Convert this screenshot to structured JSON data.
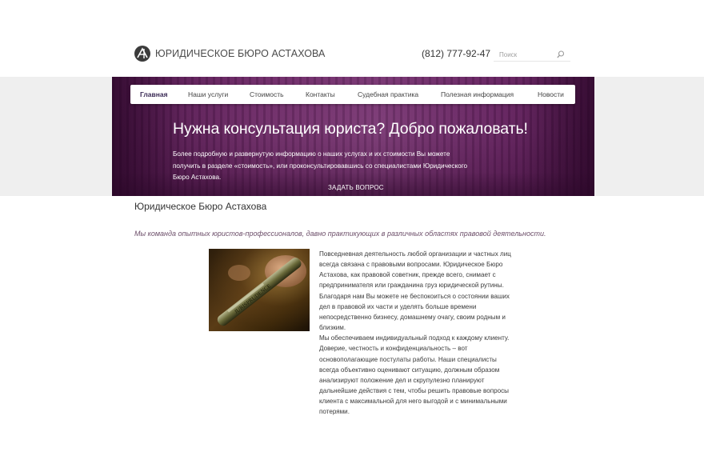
{
  "header": {
    "logo_text": "ЮРИДИЧЕСКОЕ БЮРО АСТАХОВА",
    "phone": "(812) 777-92-47",
    "search_placeholder": "Поиск"
  },
  "nav": {
    "items": [
      {
        "label": "Главная",
        "active": true
      },
      {
        "label": "Наши услуги",
        "active": false
      },
      {
        "label": "Стоимость",
        "active": false
      },
      {
        "label": "Контакты",
        "active": false
      },
      {
        "label": "Судебная практика",
        "active": false
      },
      {
        "label": "Полезная информация",
        "active": false
      },
      {
        "label": "Новости",
        "active": false
      }
    ]
  },
  "hero": {
    "title": "Нужна консультация юриста? Добро пожаловать!",
    "text": "Более подробную и  развернутую информацию о наших услугах и их стоимости Вы можете получить в разделе «стоимость», или проконсультировавшись со специалистами  Юридического Бюро Астахова.",
    "button_label": "ЗАДАТЬ ВОПРОС"
  },
  "content": {
    "title": "Юридическое Бюро Астахова",
    "tagline": "Мы команда опытных юристов-профессионалов, давно практикующих в различных областях правовой деятельности.",
    "photo_caption": "JURISPRUDENCE",
    "paragraph1": "Повседневная деятельность любой организации и частных лиц всегда связана с правовыми вопросами. Юридическое Бюро Астахова, как правовой советник, прежде всего, снимает с предпринимателя или гражданина груз юридической рутины. Благодаря нам Вы можете не беспокоиться о состоянии ваших дел в правовой их части и уделять больше времени непосредственно бизнесу, домашнему очагу, своим родным и близким.",
    "paragraph2": "Мы обеспечиваем индивидуальный подход к каждому клиенту. Доверие, честность и конфиденциальность – вот основополагающие постулаты работы. Наши специалисты всегда объективно оценивают ситуацию, должным образом анализируют положение дел и скрупулезно планируют дальнейшие действия с тем, чтобы решить правовые вопросы клиента с максимальной для него выгодой и с минимальными потерями."
  },
  "colors": {
    "accent": "#6d4f6a",
    "hero_purple": "#7a3773",
    "nav_active": "#3a2a55"
  },
  "icons": {
    "logo": "scales-logo-icon",
    "search": "search-icon"
  }
}
